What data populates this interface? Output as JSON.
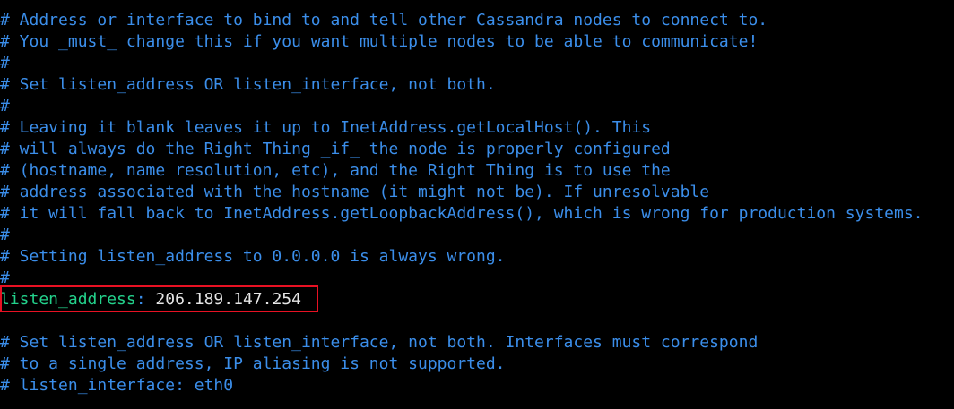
{
  "terminal": {
    "lines_before": [
      "# Address or interface to bind to and tell other Cassandra nodes to connect to.",
      "# You _must_ change this if you want multiple nodes to be able to communicate!",
      "#",
      "# Set listen_address OR listen_interface, not both.",
      "#",
      "# Leaving it blank leaves it up to InetAddress.getLocalHost(). This",
      "# will always do the Right Thing _if_ the node is properly configured",
      "# (hostname, name resolution, etc), and the Right Thing is to use the",
      "# address associated with the hostname (it might not be). If unresolvable",
      "# it will fall back to InetAddress.getLoopbackAddress(), which is wrong for production systems.",
      "#",
      "# Setting listen_address to 0.0.0.0 is always wrong.",
      "#"
    ],
    "setting": {
      "key": "listen_address",
      "separator": ":",
      "value": "206.189.147.254"
    },
    "blank": "",
    "lines_after": [
      "# Set listen_address OR listen_interface, not both. Interfaces must correspond",
      "# to a single address, IP aliasing is not supported.",
      "# listen_interface: eth0"
    ]
  },
  "colors": {
    "background": "#000000",
    "comment": "#3b8eea",
    "key": "#23d18b",
    "value": "#e5e5e5",
    "highlight_border": "#e81123"
  }
}
